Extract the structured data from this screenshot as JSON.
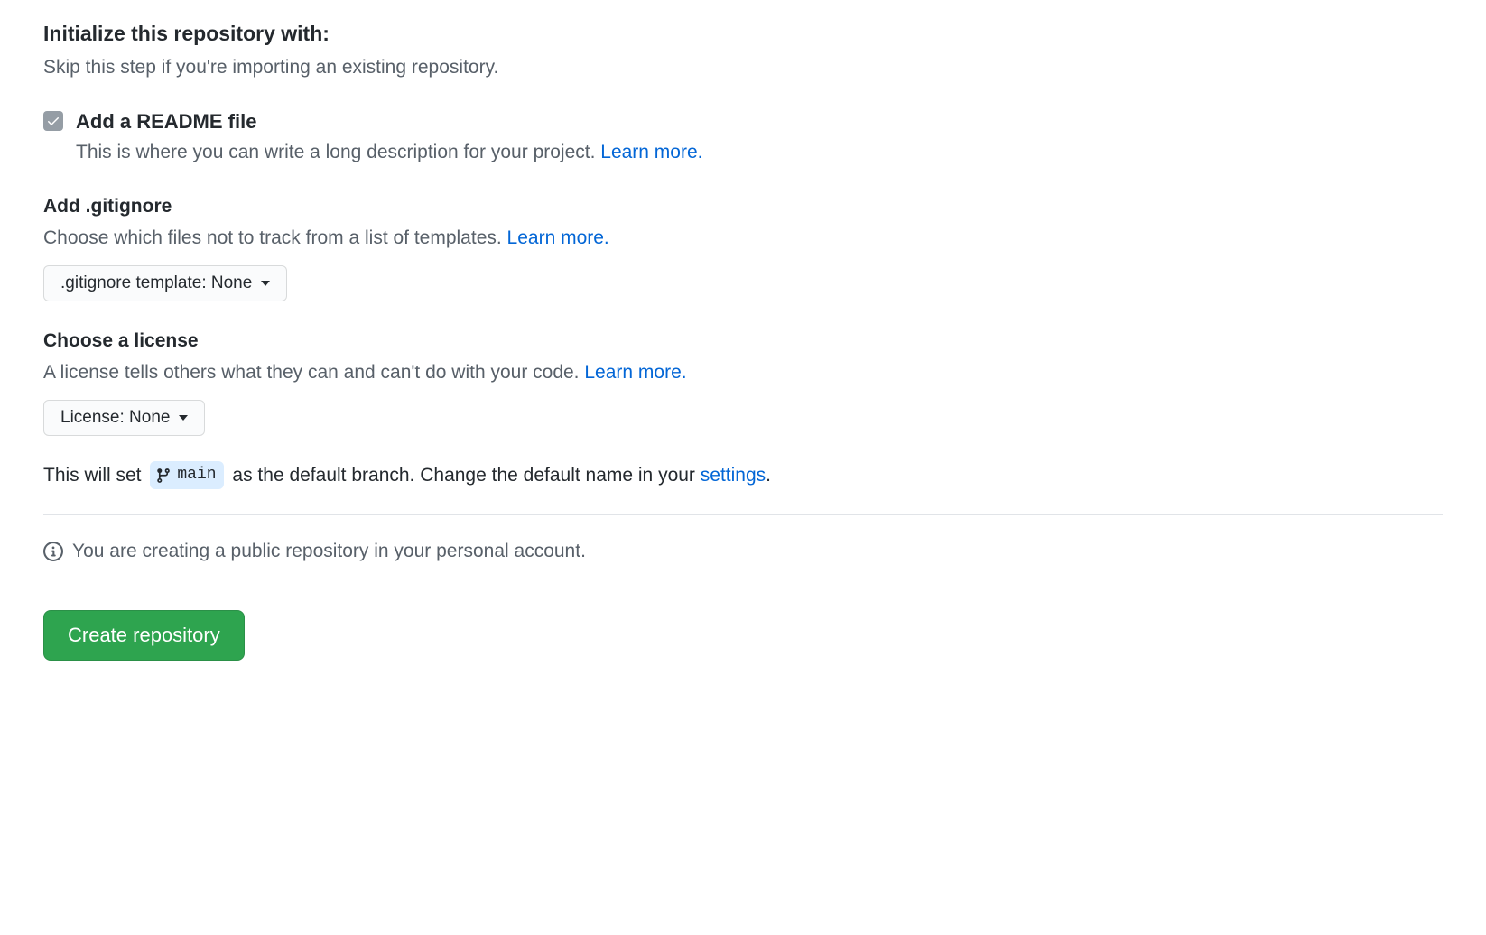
{
  "init": {
    "heading": "Initialize this repository with:",
    "subtext": "Skip this step if you're importing an existing repository."
  },
  "readme": {
    "checked": true,
    "title": "Add a README file",
    "desc": "This is where you can write a long description for your project. ",
    "learn_more": "Learn more."
  },
  "gitignore": {
    "title": "Add .gitignore",
    "desc": "Choose which files not to track from a list of templates. ",
    "learn_more": "Learn more.",
    "dropdown_label": ".gitignore template: None"
  },
  "license": {
    "title": "Choose a license",
    "desc": "A license tells others what they can and can't do with your code. ",
    "learn_more": "Learn more.",
    "dropdown_label": "License: None"
  },
  "branch": {
    "prefix": "This will set ",
    "name": "main",
    "suffix": " as the default branch. Change the default name in your ",
    "settings_link": "settings",
    "period": "."
  },
  "info_notice": "You are creating a public repository in your personal account.",
  "create_button": "Create repository"
}
